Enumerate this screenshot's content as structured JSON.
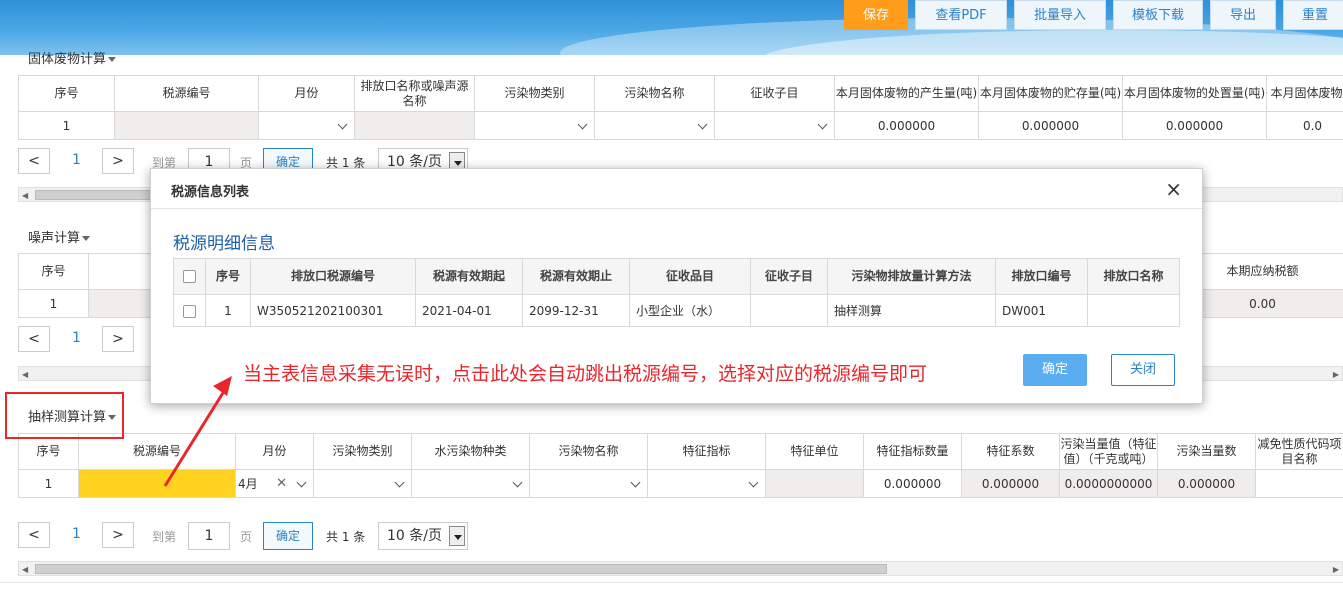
{
  "toolbar": {
    "save": "保存",
    "view_pdf": "查看PDF",
    "batch_import": "批量导入",
    "template_download": "模板下载",
    "export": "导出",
    "reset": "重置"
  },
  "solid_waste": {
    "title": "固体废物计算",
    "headers": [
      "序号",
      "税源编号",
      "月份",
      "排放口名称或噪声源名称",
      "污染物类别",
      "污染物名称",
      "征收子目",
      "本月固体废物的产生量(吨)",
      "本月固体废物的贮存量(吨)",
      "本月固体废物的处置量(吨)",
      "本月固体废物量"
    ],
    "row": {
      "index": "1",
      "production": "0.000000",
      "storage": "0.000000",
      "disposal": "0.000000",
      "last": "0.0"
    }
  },
  "pager": {
    "prev": "<",
    "next": ">",
    "page": "1",
    "goto_label": "到第",
    "page_input": "1",
    "page_label": "页",
    "confirm": "确定",
    "total": "共 1 条",
    "page_size": "10 条/页"
  },
  "noise": {
    "title": "噪声计算",
    "headers": {
      "index": "序号",
      "tax_payable": "本期应纳税额"
    },
    "row": {
      "index": "1",
      "tax": "0.00"
    }
  },
  "sampling": {
    "title": "抽样测算计算",
    "headers": [
      "序号",
      "税源编号",
      "月份",
      "污染物类别",
      "水污染物种类",
      "污染物名称",
      "特征指标",
      "特征单位",
      "特征指标数量",
      "特征系数",
      "污染当量值（特征值）（千克或吨）",
      "污染当量数",
      "减免性质代码项目名称"
    ],
    "row": {
      "index": "1",
      "month": "4月",
      "quantity": "0.000000",
      "coefficient": "0.000000",
      "equiv_value": "0.0000000000",
      "equiv_count": "0.000000"
    }
  },
  "modal": {
    "title": "税源信息列表",
    "close_icon": "×",
    "subtitle": "税源明细信息",
    "headers": [
      "序号",
      "排放口税源编号",
      "税源有效期起",
      "税源有效期止",
      "征收品目",
      "征收子目",
      "污染物排放量计算方法",
      "排放口编号",
      "排放口名称"
    ],
    "rows": [
      {
        "index": "1",
        "code": "W350521202100301",
        "start": "2021-04-01",
        "end": "2099-12-31",
        "item": "小型企业（水）",
        "subitem": "",
        "method": "抽样测算",
        "outlet_no": "DW001",
        "outlet_name": ""
      }
    ],
    "ok": "确定",
    "close": "关闭"
  },
  "annotation": "当主表信息采集无误时，点击此处会自动跳出税源编号，选择对应的税源编号即可",
  "colors": {
    "accent": "#2a83c8",
    "save": "#ff9d1b",
    "annotation": "#e8272c",
    "highlight": "#ffd21f"
  }
}
